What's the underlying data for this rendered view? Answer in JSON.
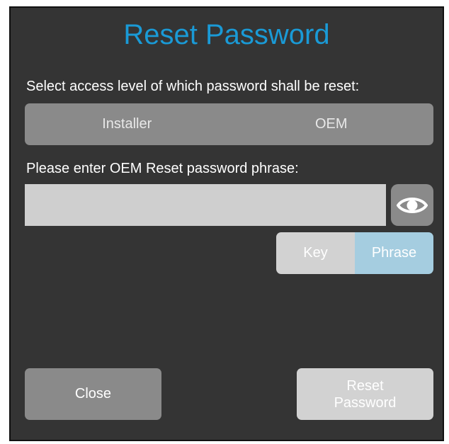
{
  "dialog": {
    "title": "Reset Password"
  },
  "access": {
    "prompt": "Select access level of which password shall be reset:",
    "options": [
      "Installer",
      "OEM"
    ]
  },
  "phrase": {
    "prompt": "Please enter OEM Reset password phrase:",
    "value": "",
    "show_password_icon": "eye-icon"
  },
  "mode": {
    "key_label": "Key",
    "phrase_label": "Phrase",
    "selected": "Phrase"
  },
  "actions": {
    "close_label": "Close",
    "reset_label_line1": "Reset",
    "reset_label_line2": "Password"
  },
  "colors": {
    "background": "#343434",
    "title": "#1a9ad6",
    "button_dark": "#8a8a8a",
    "button_light": "#d2d2d2",
    "selected_mode": "#a5cde0"
  }
}
